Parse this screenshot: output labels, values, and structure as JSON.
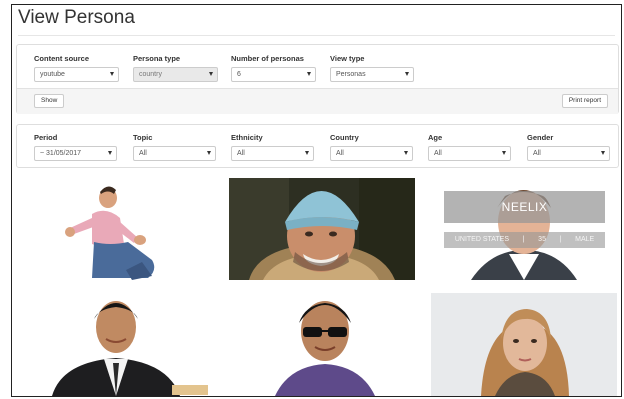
{
  "page": {
    "title": "View Persona"
  },
  "filters_top": {
    "content_source": {
      "label": "Content source",
      "value": "youtube"
    },
    "persona_type": {
      "label": "Persona type",
      "value": "country"
    },
    "number_of_personas": {
      "label": "Number of personas",
      "value": "6"
    },
    "view_type": {
      "label": "View type",
      "value": "Personas"
    },
    "show_label": "Show",
    "print_label": "Print report"
  },
  "filters_bottom": {
    "period": {
      "label": "Period",
      "value": "~ 31/05/2017"
    },
    "topic": {
      "label": "Topic",
      "value": "All"
    },
    "ethnicity": {
      "label": "Ethnicity",
      "value": "All"
    },
    "country": {
      "label": "Country",
      "value": "All"
    },
    "age": {
      "label": "Age",
      "value": "All"
    },
    "gender": {
      "label": "Gender",
      "value": "All"
    }
  },
  "hover_card": {
    "name": "NEELIX",
    "country": "UNITED STATES",
    "sep1": "|",
    "age": "35",
    "sep2": "|",
    "gender": "MALE"
  },
  "colors": {
    "accent_panel_bg": "#f5f5f5",
    "border": "#dedede",
    "overlay": "#969696"
  }
}
